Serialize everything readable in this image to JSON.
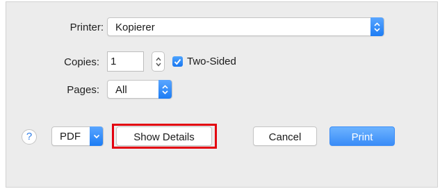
{
  "printer": {
    "label": "Printer:",
    "value": "Kopierer"
  },
  "copies": {
    "label": "Copies:",
    "value": "1",
    "two_sided_label": "Two-Sided",
    "two_sided_checked": true
  },
  "pages": {
    "label": "Pages:",
    "value": "All"
  },
  "footer": {
    "help_label": "?",
    "pdf_label": "PDF",
    "show_details_label": "Show Details",
    "cancel_label": "Cancel",
    "print_label": "Print"
  },
  "colors": {
    "accent": "#1c7cf4",
    "highlight": "#e3000f"
  },
  "icons": [
    "updown-chevron-icon",
    "checkmark-icon",
    "chevron-down-icon",
    "help-icon"
  ]
}
